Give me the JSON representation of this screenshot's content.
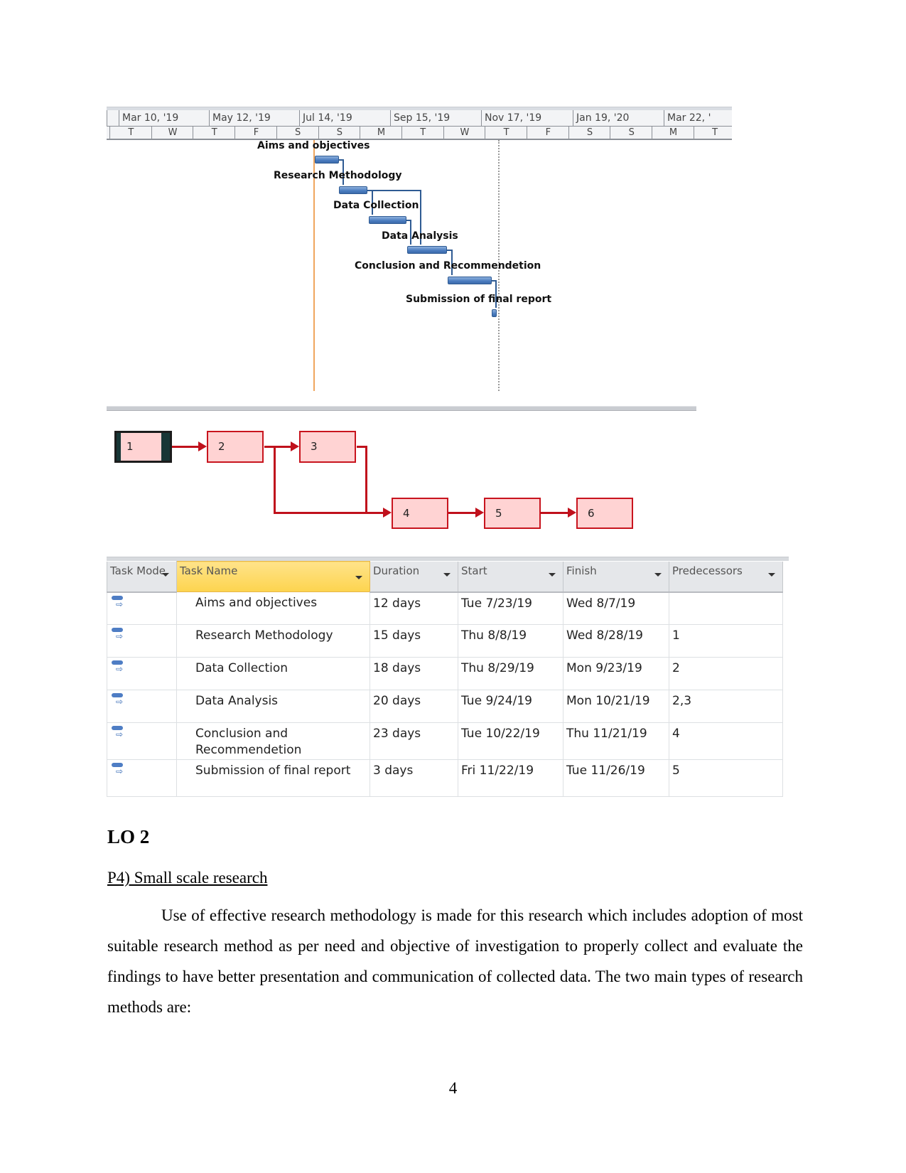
{
  "gantt": {
    "timescale_top": [
      "Mar 10, '19",
      "May 12, '19",
      "Jul 14, '19",
      "Sep 15, '19",
      "Nov 17, '19",
      "Jan 19, '20",
      "Mar 22, '"
    ],
    "timescale_bottom": [
      "T",
      "W",
      "T",
      "F",
      "S",
      "S",
      "M",
      "T",
      "W",
      "T",
      "F",
      "S",
      "S",
      "M",
      "T"
    ],
    "bar_color": "#4a7cbf",
    "today_line_color": "#f0a65e",
    "tasks": [
      {
        "label": "Aims and objectives"
      },
      {
        "label": "Research Methodology"
      },
      {
        "label": "Data Collection"
      },
      {
        "label": "Data Analysis"
      },
      {
        "label": "Conclusion and Recommendetion"
      },
      {
        "label": "Submission of final report"
      }
    ]
  },
  "network": {
    "node_fill": "#ffd3d3",
    "edge_color": "#c0111c",
    "nodes": [
      "1",
      "2",
      "3",
      "4",
      "5",
      "6"
    ]
  },
  "table": {
    "headers": [
      "Task Mode",
      "Task Name",
      "Duration",
      "Start",
      "Finish",
      "Predecessors"
    ],
    "rows": [
      {
        "name": "Aims and objectives",
        "duration": "12 days",
        "start": "Tue 7/23/19",
        "finish": "Wed 8/7/19",
        "predecessors": ""
      },
      {
        "name": "Research Methodology",
        "duration": "15 days",
        "start": "Thu 8/8/19",
        "finish": "Wed 8/28/19",
        "predecessors": "1"
      },
      {
        "name": "Data Collection",
        "duration": "18 days",
        "start": "Thu 8/29/19",
        "finish": "Mon 9/23/19",
        "predecessors": "2"
      },
      {
        "name": "Data Analysis",
        "duration": "20 days",
        "start": "Tue 9/24/19",
        "finish": "Mon 10/21/19",
        "predecessors": "2,3"
      },
      {
        "name": "Conclusion and Recommendetion",
        "duration": "23 days",
        "start": "Tue 10/22/19",
        "finish": "Thu 11/21/19",
        "predecessors": "4"
      },
      {
        "name": "Submission of final report",
        "duration": "3 days",
        "start": "Fri 11/22/19",
        "finish": "Tue 11/26/19",
        "predecessors": "5"
      }
    ]
  },
  "document": {
    "heading": "LO 2",
    "subheading": "P4) Small scale research",
    "paragraph": "Use of effective research methodology is made for this research which includes adoption of most suitable research method as per need and objective of investigation to properly collect and evaluate the findings to have better presentation and communication of collected data. The two main types of research methods are:",
    "page_number": "4"
  }
}
